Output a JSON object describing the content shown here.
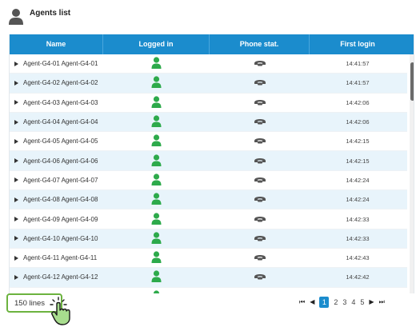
{
  "header": {
    "title": "Agents list",
    "icon": "user-icon"
  },
  "columns": [
    "Name",
    "Logged in",
    "Phone stat.",
    "First login"
  ],
  "rows": [
    {
      "name": "Agent-G4-01 Agent-G4-01",
      "logged_in_icon": "person-icon",
      "phone_icon": "phone-icon",
      "first_login": "14:41:57"
    },
    {
      "name": "Agent-G4-02 Agent-G4-02",
      "logged_in_icon": "person-icon",
      "phone_icon": "phone-icon",
      "first_login": "14:41:57"
    },
    {
      "name": "Agent-G4-03 Agent-G4-03",
      "logged_in_icon": "person-icon",
      "phone_icon": "phone-icon",
      "first_login": "14:42:06"
    },
    {
      "name": "Agent-G4-04 Agent-G4-04",
      "logged_in_icon": "person-icon",
      "phone_icon": "phone-icon",
      "first_login": "14:42:06"
    },
    {
      "name": "Agent-G4-05 Agent-G4-05",
      "logged_in_icon": "person-icon",
      "phone_icon": "phone-icon",
      "first_login": "14:42:15"
    },
    {
      "name": "Agent-G4-06 Agent-G4-06",
      "logged_in_icon": "person-icon",
      "phone_icon": "phone-icon",
      "first_login": "14:42:15"
    },
    {
      "name": "Agent-G4-07 Agent-G4-07",
      "logged_in_icon": "person-icon",
      "phone_icon": "phone-icon",
      "first_login": "14:42:24"
    },
    {
      "name": "Agent-G4-08 Agent-G4-08",
      "logged_in_icon": "person-icon",
      "phone_icon": "phone-icon",
      "first_login": "14:42:24"
    },
    {
      "name": "Agent-G4-09 Agent-G4-09",
      "logged_in_icon": "person-icon",
      "phone_icon": "phone-icon",
      "first_login": "14:42:33"
    },
    {
      "name": "Agent-G4-10 Agent-G4-10",
      "logged_in_icon": "person-icon",
      "phone_icon": "phone-icon",
      "first_login": "14:42:33"
    },
    {
      "name": "Agent-G4-11 Agent-G4-11",
      "logged_in_icon": "person-icon",
      "phone_icon": "phone-icon",
      "first_login": "14:42:43"
    },
    {
      "name": "Agent-G4-12 Agent-G4-12",
      "logged_in_icon": "person-icon",
      "phone_icon": "phone-icon",
      "first_login": "14:42:42"
    },
    {
      "name": "",
      "logged_in_icon": "person-icon",
      "phone_icon": "phone-icon",
      "first_login": ""
    }
  ],
  "footer": {
    "lines_label": "150 lines",
    "pager": {
      "first": "⏮",
      "prev": "◀",
      "pages": [
        "1",
        "2",
        "3",
        "4",
        "5"
      ],
      "current": "1",
      "next": "▶",
      "last": "⏭"
    }
  },
  "colors": {
    "header_bg": "#1b8ccd",
    "row_alt": "#e8f4fb",
    "logged_in_green": "#2daa4b",
    "phone_gray": "#555555",
    "highlight_green": "#6cb33f"
  }
}
